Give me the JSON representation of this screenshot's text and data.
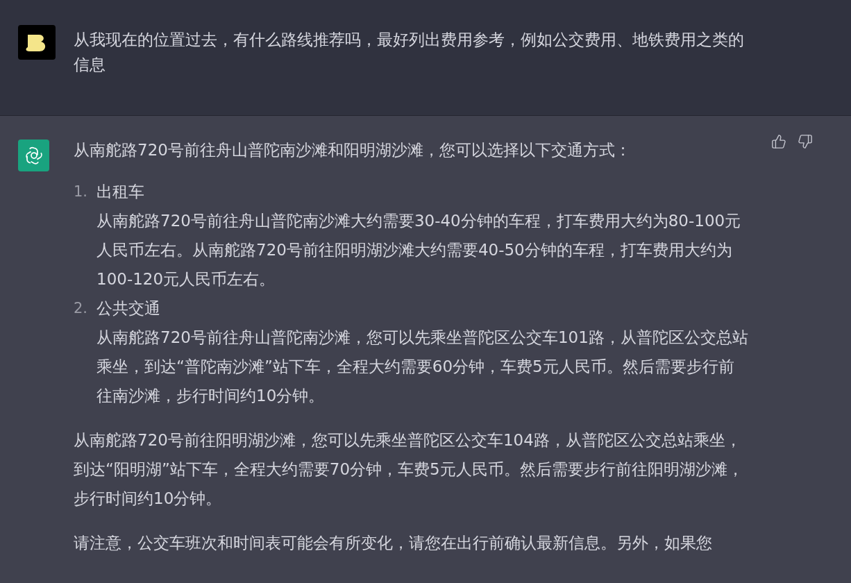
{
  "user_message": {
    "text": "从我现在的位置过去，有什么路线推荐吗，最好列出费用参考，例如公交费用、地铁费用之类的信息"
  },
  "assistant_message": {
    "intro": "从南舵路720号前往舟山普陀南沙滩和阳明湖沙滩，您可以选择以下交通方式：",
    "list": [
      {
        "number": "1.",
        "title": "出租车",
        "body": "从南舵路720号前往舟山普陀南沙滩大约需要30-40分钟的车程，打车费用大约为80-100元人民币左右。从南舵路720号前往阳明湖沙滩大约需要40-50分钟的车程，打车费用大约为100-120元人民币左右。"
      },
      {
        "number": "2.",
        "title": "公共交通",
        "body": "从南舵路720号前往舟山普陀南沙滩，您可以先乘坐普陀区公交车101路，从普陀区公交总站乘坐，到达“普陀南沙滩”站下车，全程大约需要60分钟，车费5元人民币。然后需要步行前往南沙滩，步行时间约10分钟。"
      }
    ],
    "paragraphs": [
      "从南舵路720号前往阳明湖沙滩，您可以先乘坐普陀区公交车104路，从普陀区公交总站乘坐，到达“阳明湖”站下车，全程大约需要70分钟，车费5元人民币。然后需要步行前往阳明湖沙滩，步行时间约10分钟。",
      "请注意，公交车班次和时间表可能会有所变化，请您在出行前确认最新信息。另外，如果您"
    ]
  }
}
